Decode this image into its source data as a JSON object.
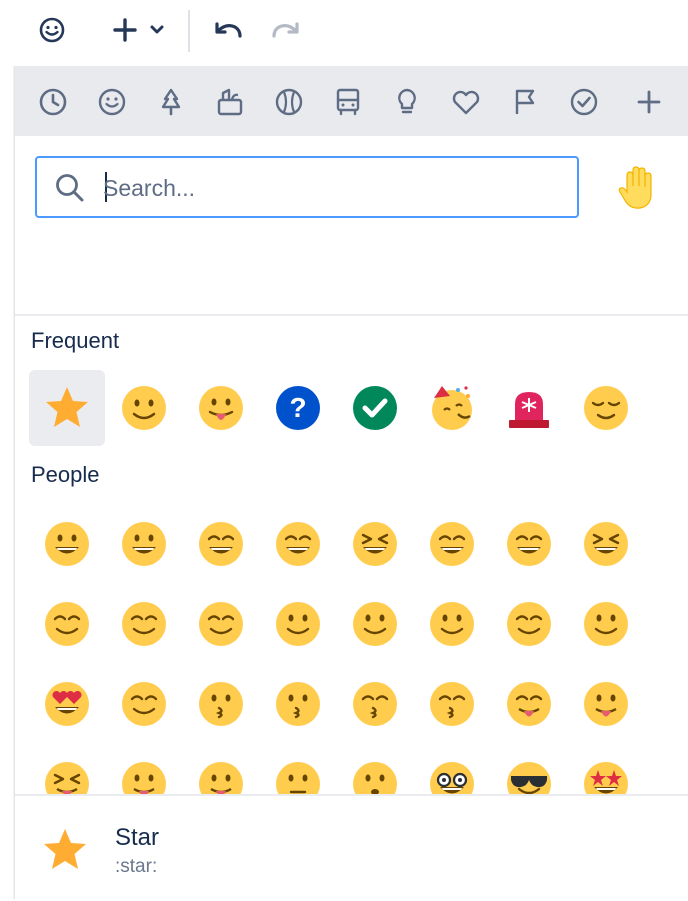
{
  "toolbar": {
    "buttons": [
      {
        "name": "emoji-icon"
      },
      {
        "name": "insert-plus-icon"
      },
      {
        "name": "undo-icon"
      },
      {
        "name": "redo-icon"
      }
    ]
  },
  "categories": [
    {
      "name": "clock-icon",
      "label": "Frequent"
    },
    {
      "name": "smiley-icon",
      "label": "People"
    },
    {
      "name": "tree-icon",
      "label": "Nature"
    },
    {
      "name": "food-icon",
      "label": "Food"
    },
    {
      "name": "ball-icon",
      "label": "Activity"
    },
    {
      "name": "bus-icon",
      "label": "Travel"
    },
    {
      "name": "lightbulb-icon",
      "label": "Objects"
    },
    {
      "name": "heart-icon",
      "label": "Symbols"
    },
    {
      "name": "flag-icon",
      "label": "Flags"
    },
    {
      "name": "check-circle-icon",
      "label": "Productivity"
    },
    {
      "name": "add-icon",
      "label": "Add"
    }
  ],
  "search": {
    "placeholder": "Search...",
    "value": ""
  },
  "sections": {
    "frequent": "Frequent",
    "people": "People"
  },
  "frequent": [
    {
      "name": "star-emoji",
      "char": "★"
    },
    {
      "name": "slightly-smiling-emoji",
      "char": "🙂"
    },
    {
      "name": "tongue-out-emoji",
      "char": "😛"
    },
    {
      "name": "question-emoji",
      "char": "?"
    },
    {
      "name": "check-mark-emoji",
      "char": "✓"
    },
    {
      "name": "partying-face-emoji",
      "char": "🥳"
    },
    {
      "name": "rotating-light-emoji",
      "char": "🚨"
    },
    {
      "name": "relieved-emoji",
      "char": "😌"
    }
  ],
  "footer": {
    "name": "Star",
    "shortcode": ":star:"
  },
  "colors": {
    "accent": "#4c9aff",
    "face": "#ffcc4d",
    "star": "#ffac33",
    "question": "#0052cc",
    "check": "#00875a",
    "siren": "#e0245e"
  }
}
